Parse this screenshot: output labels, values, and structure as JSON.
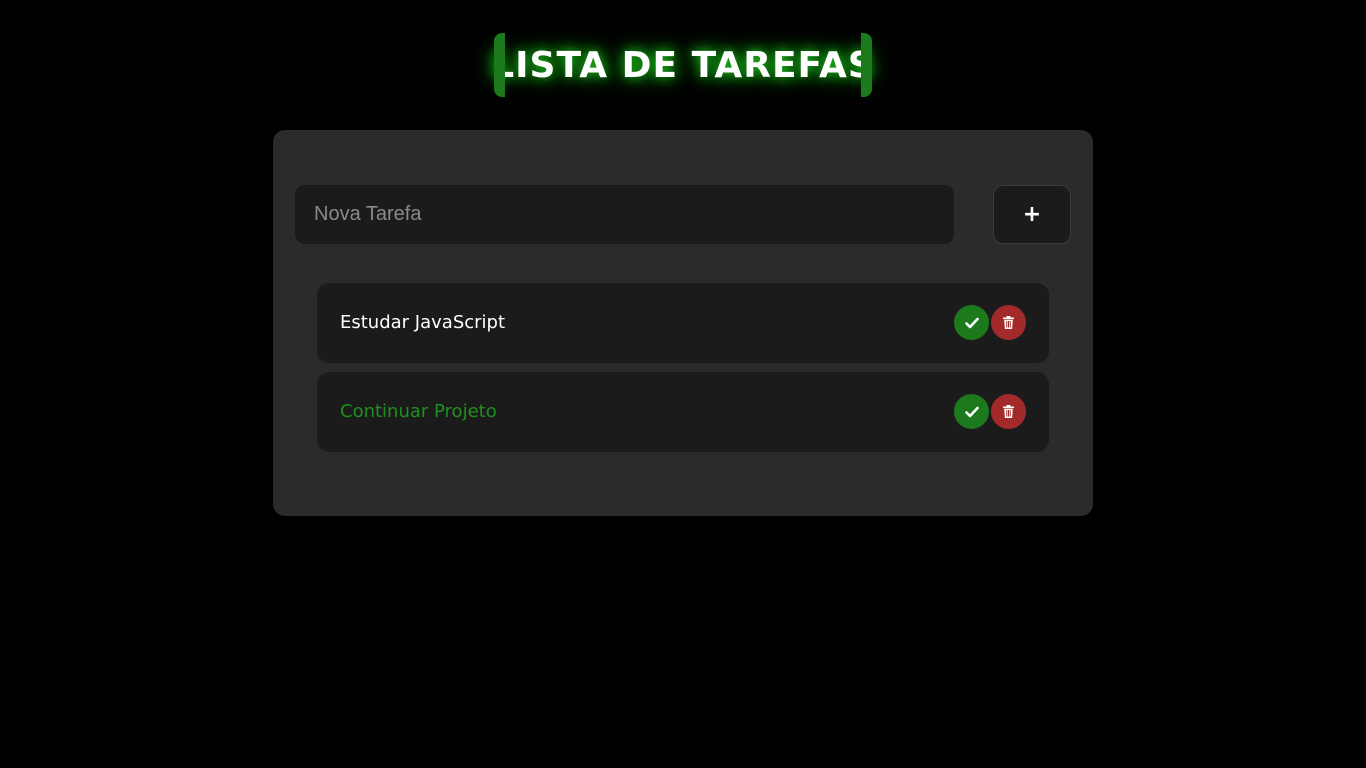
{
  "header": {
    "title": "LISTA DE TAREFAS"
  },
  "form": {
    "placeholder": "Nova Tarefa",
    "add_icon": "plus-icon",
    "add_label": "+"
  },
  "tasks": [
    {
      "label": "Estudar JavaScript",
      "completed": false,
      "text_color": "#ffffff"
    },
    {
      "label": "Continuar Projeto",
      "completed": true,
      "text_color": "#1f8f1f"
    }
  ],
  "icons": {
    "complete": "check-icon",
    "delete": "trash-icon"
  },
  "colors": {
    "accent_green": "#1c7a1c",
    "delete_red": "#a32a2a",
    "card_bg": "#2b2b2b",
    "item_bg": "#1b1b1b",
    "page_bg": "#000000"
  }
}
